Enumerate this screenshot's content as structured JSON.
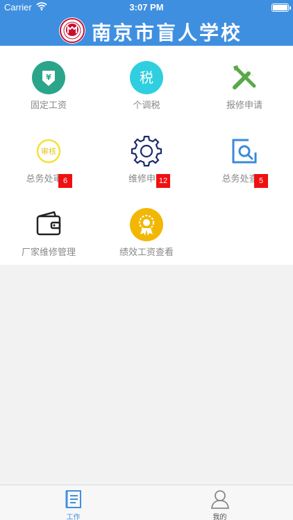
{
  "status_bar": {
    "carrier": "Carrier",
    "time": "3:07 PM",
    "battery_level": 1.0
  },
  "header": {
    "logo_icon": "school-seal-icon",
    "title": "南京市盲人学校"
  },
  "grid": {
    "items": [
      {
        "label": "固定工资",
        "icon": "fixed-salary-icon",
        "badge": ""
      },
      {
        "label": "个调税",
        "icon": "tax-icon",
        "icon_text": "税",
        "badge": ""
      },
      {
        "label": "报修申请",
        "icon": "repair-tools-icon",
        "badge": ""
      },
      {
        "label": "总务处审核",
        "icon": "review-icon",
        "icon_text": "审核",
        "badge": "6"
      },
      {
        "label": "维修申请",
        "icon": "gear-icon",
        "badge": "12"
      },
      {
        "label": "总务处查看",
        "icon": "search-view-icon",
        "badge": "5"
      },
      {
        "label": "厂家维修管理",
        "icon": "wallet-icon",
        "badge": ""
      },
      {
        "label": "绩效工资查看",
        "icon": "award-icon",
        "badge": ""
      }
    ]
  },
  "tabbar": {
    "tabs": [
      {
        "label": "工作",
        "icon": "document-icon",
        "active": true
      },
      {
        "label": "我的",
        "icon": "user-icon",
        "active": false
      }
    ]
  },
  "colors": {
    "header": "#3f8fe0",
    "active_tab": "#3f8fe0",
    "badge": "#f01010",
    "fixed_salary": "#2aa58a",
    "tax": "#2fcfe0",
    "repair": "#5aa84a",
    "review": "#f3e23a",
    "gear": "#1a2a6a",
    "search_view": "#3a8ad8",
    "award": "#f2b705"
  }
}
